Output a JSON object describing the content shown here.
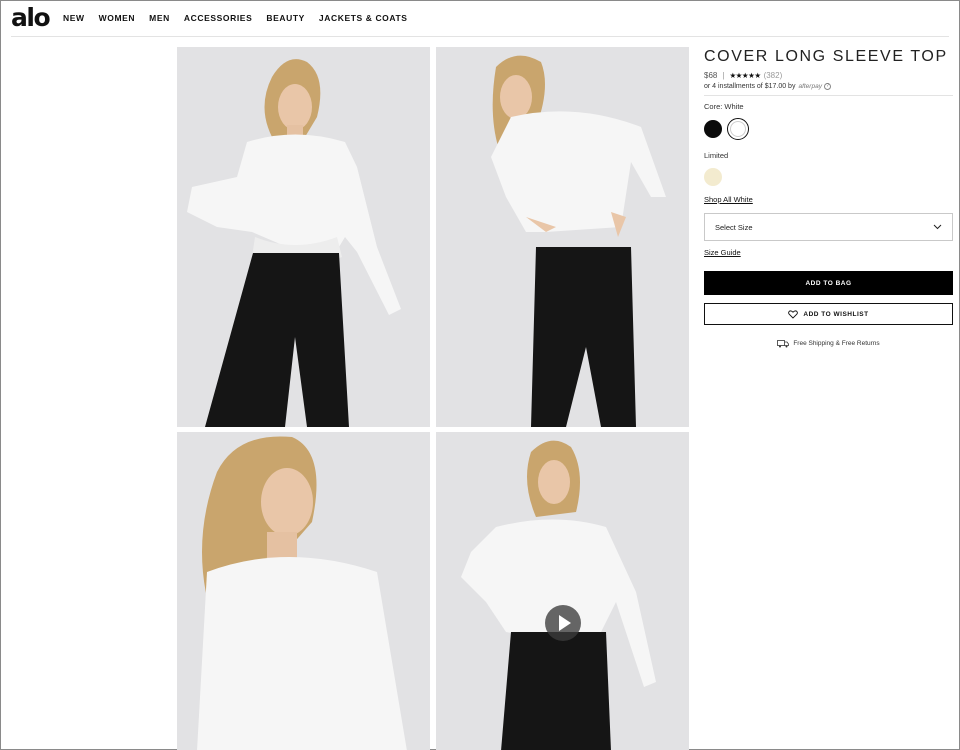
{
  "header": {
    "logo": "alo",
    "nav": [
      "NEW",
      "WOMEN",
      "MEN",
      "ACCESSORIES",
      "BEAUTY",
      "JACKETS & COATS"
    ]
  },
  "product": {
    "title": "COVER LONG SLEEVE TOP",
    "price": "$68",
    "rating_stars": "★★★★★",
    "rating": 5,
    "review_count": "(382)",
    "installments": "or 4 installments of $17.00 by",
    "afterpay": "afterpay",
    "color_label": "Core: White",
    "core_colors": [
      {
        "name": "black",
        "hex": "#0b0b0b"
      },
      {
        "name": "white",
        "hex": "#ffffff",
        "selected": true
      }
    ],
    "limited_label": "Limited",
    "limited_colors": [
      {
        "name": "cream",
        "hex": "#f3ebcf"
      }
    ],
    "shop_all_link": "Shop All White",
    "size_select": "Select Size",
    "size_guide": "Size Guide",
    "add_to_bag": "ADD TO BAG",
    "add_to_wishlist": "ADD TO WISHLIST",
    "shipping": "Free Shipping & Free Returns"
  },
  "icons": {
    "chevron": "chevron-down-icon",
    "heart": "heart-icon",
    "truck": "truck-icon",
    "play": "play-icon",
    "info": "info-icon"
  },
  "colors": {
    "primary": "#000000",
    "photo_bg": "#e2e2e4",
    "top": "#f6f6f6",
    "leggings": "#151515"
  }
}
